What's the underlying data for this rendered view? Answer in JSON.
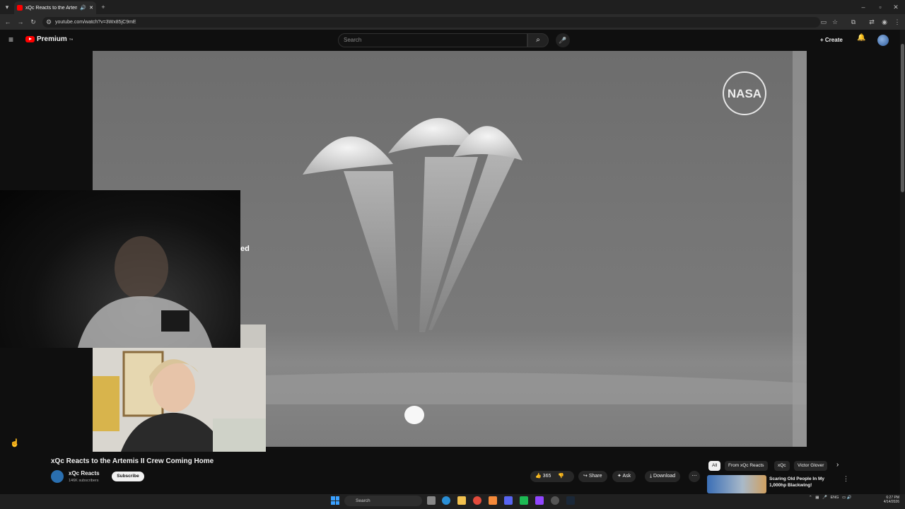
{
  "browser": {
    "tab_title": "xQc Reacts to the Artemis II C",
    "url": "youtube.com/watch?v=3Wx85jC9mE",
    "nav_icons": [
      "back-icon",
      "forward-icon",
      "reload-icon",
      "site-info-icon"
    ]
  },
  "youtube": {
    "logo_text": "Premium",
    "logo_sup": "TH",
    "search_placeholder": "Search",
    "create_label": "Create"
  },
  "video": {
    "watermark": "NASA",
    "overlay_fragment": "ed"
  },
  "details": {
    "title": "xQc Reacts to the Artemis II Crew Coming Home",
    "channel_name": "xQc Reacts",
    "subscribers": "146K subscribers",
    "subscribe_label": "Subscribe",
    "like_count": "365",
    "share_label": "Share",
    "ask_label": "Ask",
    "download_label": "Download"
  },
  "recommendations": {
    "chips": [
      "All",
      "From xQc Reacts",
      "xQc",
      "Victor Glover"
    ],
    "first_title": "Scaring Old People In My 1,000hp Blackwing!"
  },
  "taskbar": {
    "search_label": "Search",
    "tray_language": "ENG",
    "time": "6:27 PM",
    "date": "4/14/2026"
  },
  "colors": {
    "yt_red": "#ff0000",
    "background": "#0f0f0f",
    "pill": "#272727"
  }
}
